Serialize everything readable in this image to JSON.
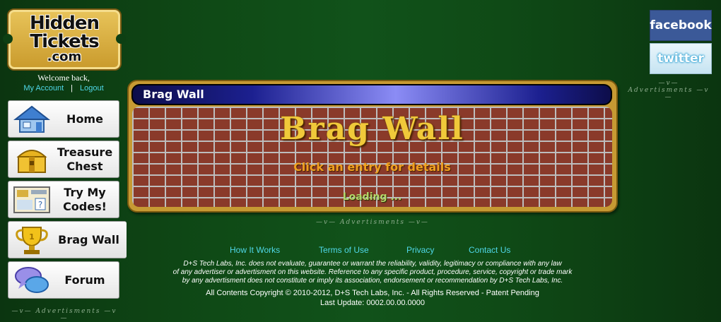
{
  "logo": {
    "line1": "Hidden",
    "line2": "Tickets",
    "line3": ".com"
  },
  "welcome": "Welcome back,",
  "account": {
    "my_account": "My Account",
    "separator": "|",
    "logout": "Logout"
  },
  "nav": {
    "items": [
      {
        "label": "Home",
        "icon": "house-icon"
      },
      {
        "label": "Treasure Chest",
        "icon": "treasure-chest-icon"
      },
      {
        "label": "Try My Codes!",
        "icon": "codes-ticket-icon"
      },
      {
        "label": "Brag Wall",
        "icon": "trophy-icon",
        "active": true
      },
      {
        "label": "Forum",
        "icon": "chat-bubbles-icon"
      }
    ]
  },
  "ads": {
    "label": "Advertisments"
  },
  "social": {
    "facebook": "facebook",
    "twitter": "twitter"
  },
  "panel": {
    "header": "Brag Wall",
    "title": "Brag Wall",
    "subtitle": "Click an entry for details",
    "loading": "Loading ..."
  },
  "footer": {
    "links": [
      "How It Works",
      "Terms of Use",
      "Privacy",
      "Contact Us"
    ],
    "disclaimer_1": "D+S Tech Labs, Inc. does not evaluate, guarantee or warrant the reliability, validity, legitimacy or compliance with any law",
    "disclaimer_2": "of any advertiser or advertisment on this website. Reference to any specific product, procedure, service, copyright or trade mark",
    "disclaimer_3": "by any advertisment does not constitute or imply its association, endorsement or recommendation by D+S Tech Labs, Inc.",
    "copyright": "All Contents Copyright © 2010-2012, D+S Tech Labs, Inc. - All Rights Reserved - Patent Pending",
    "last_update": "Last Update: 0002.00.00.0000"
  },
  "colors": {
    "background": "#0f4a16",
    "link": "#4fd8e8",
    "panel_gold": "#c79a33",
    "header_blue": "#1c2090",
    "brag_yellow": "#f0c93a"
  }
}
